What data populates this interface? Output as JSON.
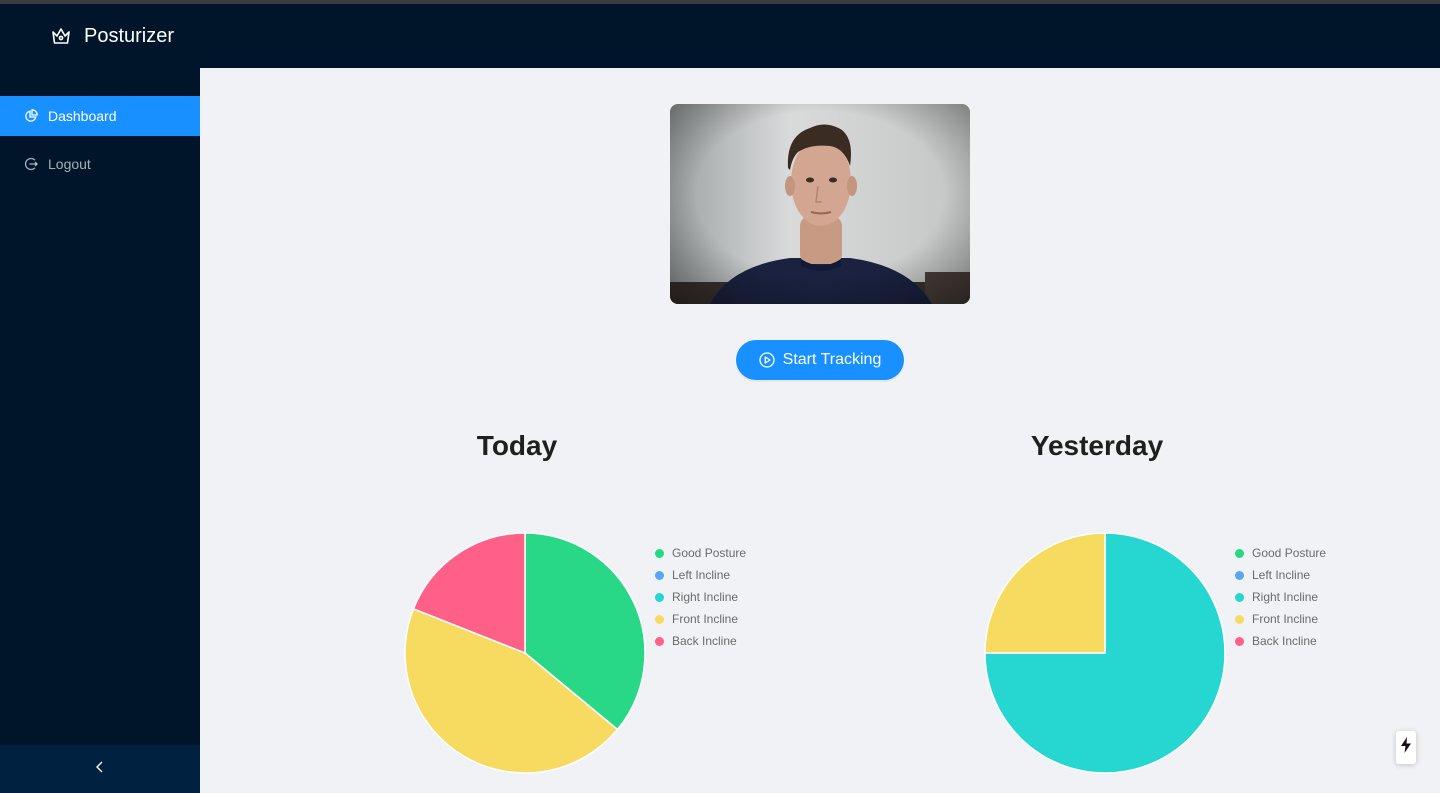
{
  "app": {
    "title": "Posturizer"
  },
  "sidebar": {
    "items": [
      {
        "label": "Dashboard",
        "icon": "pie-chart-icon",
        "active": true
      },
      {
        "label": "Logout",
        "icon": "logout-icon",
        "active": false
      }
    ],
    "collapse_icon": "chevron-left-icon"
  },
  "main": {
    "webcam": {
      "description_icon": "camera-feed"
    },
    "start_button": {
      "label": "Start Tracking",
      "icon": "play-circle-icon"
    }
  },
  "colors": {
    "header_bg": "#001529",
    "accent": "#1890ff",
    "good_posture": "#28d886",
    "left_incline": "#58a6f4",
    "right_incline": "#25d6d1",
    "front_incline": "#f7da60",
    "back_incline": "#fe6087"
  },
  "chart_data": [
    {
      "type": "pie",
      "title": "Today",
      "legend_position": "right",
      "categories": [
        "Good Posture",
        "Left Incline",
        "Right Incline",
        "Front Incline",
        "Back Incline"
      ],
      "values": [
        36,
        0,
        0,
        45,
        19
      ],
      "colors": [
        "#28d886",
        "#58a6f4",
        "#25d6d1",
        "#f7da60",
        "#fe6087"
      ]
    },
    {
      "type": "pie",
      "title": "Yesterday",
      "legend_position": "right",
      "categories": [
        "Good Posture",
        "Left Incline",
        "Right Incline",
        "Front Incline",
        "Back Incline"
      ],
      "values": [
        0,
        0,
        75,
        25,
        0
      ],
      "colors": [
        "#28d886",
        "#58a6f4",
        "#25d6d1",
        "#f7da60",
        "#fe6087"
      ]
    }
  ]
}
